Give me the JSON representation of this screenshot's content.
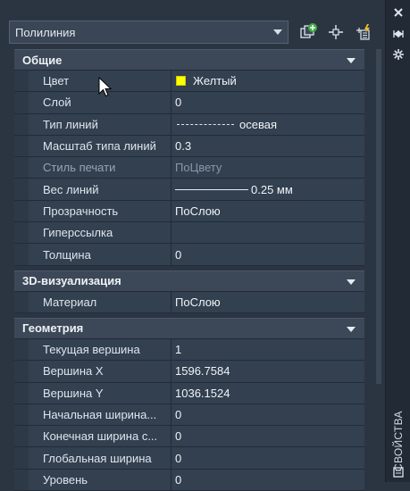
{
  "object_selector": {
    "value": "Полилиния"
  },
  "toolbar": {
    "icons": [
      "toggle-pickadd-icon",
      "select-objects-icon",
      "quick-select-icon"
    ]
  },
  "sections": [
    {
      "title": "Общие",
      "rows": [
        {
          "name": "Цвет",
          "value": "Желтый",
          "kind": "color",
          "color": "#ffff00"
        },
        {
          "name": "Слой",
          "value": "0"
        },
        {
          "name": "Тип линий",
          "value": "осевая",
          "kind": "linetype"
        },
        {
          "name": "Масштаб типа линий",
          "value": "0.3"
        },
        {
          "name": "Стиль печати",
          "value": "ПоЦвету",
          "dim": true
        },
        {
          "name": "Вес линий",
          "value": "0.25 мм",
          "kind": "lineweight"
        },
        {
          "name": "Прозрачность",
          "value": "ПоСлою"
        },
        {
          "name": "Гиперссылка",
          "value": ""
        },
        {
          "name": "Толщина",
          "value": "0"
        }
      ]
    },
    {
      "title": "3D-визуализация",
      "rows": [
        {
          "name": "Материал",
          "value": "ПоСлою"
        }
      ]
    },
    {
      "title": "Геометрия",
      "rows": [
        {
          "name": "Текущая вершина",
          "value": "1"
        },
        {
          "name": "Вершина X",
          "value": "1596.7584"
        },
        {
          "name": "Вершина Y",
          "value": "1036.1524"
        },
        {
          "name": "Начальная ширина...",
          "value": "0"
        },
        {
          "name": "Конечная ширина с...",
          "value": "0"
        },
        {
          "name": "Глобальная ширина",
          "value": "0"
        },
        {
          "name": "Уровень",
          "value": "0"
        }
      ]
    }
  ],
  "palette_title": "СВОЙСТВА",
  "side_icons": [
    "close-icon",
    "auto-hide-icon",
    "properties-menu-icon"
  ]
}
